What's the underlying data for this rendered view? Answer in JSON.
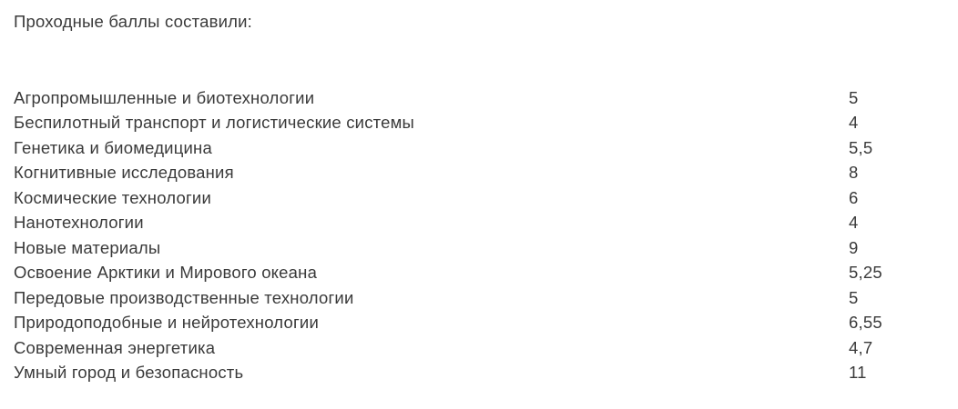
{
  "intro": "Проходные баллы составили:",
  "scores": [
    {
      "name": "Агропромышленные и биотехнологии",
      "value": "5"
    },
    {
      "name": "Беспилотный транспорт и логистические системы",
      "value": "4"
    },
    {
      "name": "Генетика и биомедицина",
      "value": "5,5"
    },
    {
      "name": "Когнитивные исследования",
      "value": "8"
    },
    {
      "name": "Космические технологии",
      "value": "6"
    },
    {
      "name": "Нанотехнологии",
      "value": "4"
    },
    {
      "name": "Новые материалы",
      "value": "9"
    },
    {
      "name": "Освоение Арктики и Мирового океана",
      "value": "5,25"
    },
    {
      "name": "Передовые производственные технологии",
      "value": "5"
    },
    {
      "name": "Природоподобные и нейротехнологии",
      "value": "6,55"
    },
    {
      "name": "Современная энергетика",
      "value": "4,7"
    },
    {
      "name": "Умный город и безопасность",
      "value": "11"
    }
  ]
}
